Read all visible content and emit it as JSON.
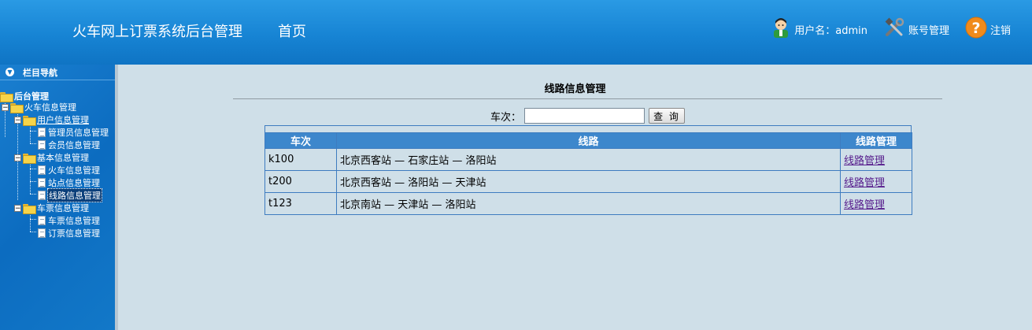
{
  "header": {
    "title": "火车网上订票系统后台管理",
    "home": "首页",
    "user_label": "用户名：admin",
    "account": "账号管理",
    "logout": "注销"
  },
  "sidebar": {
    "heading": "栏目导航",
    "tree": {
      "root": "后台管理",
      "train_info": "火车信息管理",
      "user_info": "用户信息管理",
      "admin_info": "管理员信息管理",
      "member_info": "会员信息管理",
      "basic_info": "基本信息管理",
      "train_mgmt": "火车信息管理",
      "station_mgmt": "站点信息管理",
      "route_mgmt": "线路信息管理",
      "ticket_info": "车票信息管理",
      "ticket_mgmt": "车票信息管理",
      "order_mgmt": "订票信息管理"
    }
  },
  "main": {
    "title": "线路信息管理",
    "search_label": "车次：",
    "search_value": "",
    "search_button": "查 询",
    "columns": [
      "车次",
      "线路",
      "线路管理"
    ],
    "rows": [
      {
        "train": "k100",
        "route": "北京西客站 — 石家庄站 — 洛阳站",
        "action": "线路管理"
      },
      {
        "train": "t200",
        "route": "北京西客站 — 洛阳站 — 天津站",
        "action": "线路管理"
      },
      {
        "train": "t123",
        "route": "北京南站 — 天津站 — 洛阳站",
        "action": "线路管理"
      }
    ]
  },
  "colors": {
    "header_blue": "#1784d4",
    "sidebar_blue": "#0c6cc0",
    "content_bg": "#cfdfe8",
    "table_header": "#3d87cc",
    "link_visited": "#551a8b"
  },
  "icons": [
    "user-avatar-icon",
    "tools-icon",
    "help-question-icon",
    "collapse-circle-icon",
    "folder-icon",
    "document-icon"
  ]
}
